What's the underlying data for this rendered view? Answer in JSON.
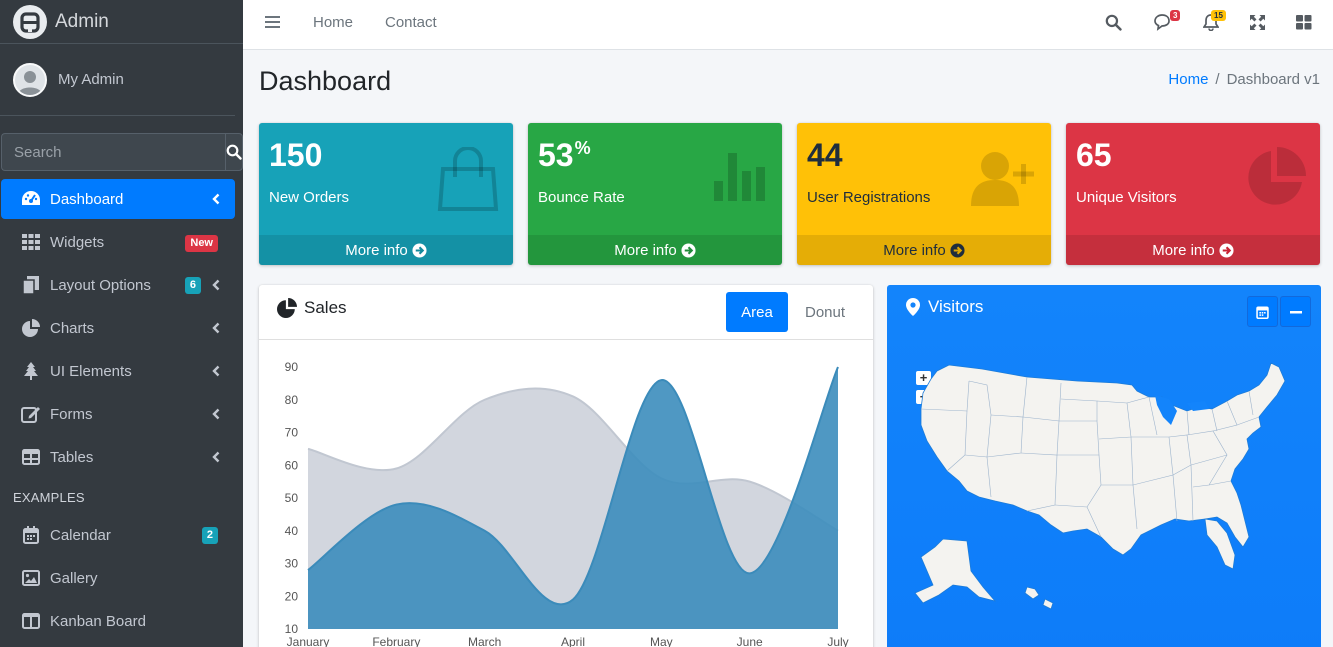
{
  "brand": {
    "name": "Admin"
  },
  "user": {
    "name": "My Admin"
  },
  "search": {
    "placeholder": "Search"
  },
  "sidebar": {
    "items": [
      {
        "label": "Dashboard",
        "icon": "tachometer-icon"
      },
      {
        "label": "Widgets",
        "icon": "grid-icon",
        "badge": "New"
      },
      {
        "label": "Layout Options",
        "icon": "copy-icon",
        "badge": "6"
      },
      {
        "label": "Charts",
        "icon": "pie-chart-icon"
      },
      {
        "label": "UI Elements",
        "icon": "tree-icon"
      },
      {
        "label": "Forms",
        "icon": "edit-icon"
      },
      {
        "label": "Tables",
        "icon": "table-icon"
      }
    ],
    "section_header": "EXAMPLES",
    "examples": [
      {
        "label": "Calendar",
        "icon": "calendar-icon",
        "badge": "2"
      },
      {
        "label": "Gallery",
        "icon": "image-icon"
      },
      {
        "label": "Kanban Board",
        "icon": "columns-icon"
      }
    ]
  },
  "topnav": {
    "links": [
      "Home",
      "Contact"
    ],
    "messages_count": "3",
    "notifications_count": "15"
  },
  "page": {
    "title": "Dashboard"
  },
  "breadcrumb": {
    "home": "Home",
    "current": "Dashboard v1"
  },
  "stats": [
    {
      "value": "150",
      "suffix": "",
      "label": "New Orders",
      "footer": "More info",
      "color": "#17a2b8",
      "icon": "shopping-bag-icon"
    },
    {
      "value": "53",
      "suffix": "%",
      "label": "Bounce Rate",
      "footer": "More info",
      "color": "#28a745",
      "icon": "bar-chart-icon"
    },
    {
      "value": "44",
      "suffix": "",
      "label": "User Registrations",
      "footer": "More info",
      "color": "#ffc107",
      "icon": "user-plus-icon"
    },
    {
      "value": "65",
      "suffix": "",
      "label": "Unique Visitors",
      "footer": "More info",
      "color": "#dc3545",
      "icon": "pie-chart-icon"
    }
  ],
  "sales": {
    "title": "Sales",
    "tabs": [
      "Area",
      "Donut"
    ],
    "active_tab": "Area"
  },
  "visitors": {
    "title": "Visitors"
  },
  "chart_data": {
    "type": "area",
    "categories": [
      "January",
      "February",
      "March",
      "April",
      "May",
      "June",
      "July"
    ],
    "ylim": [
      10,
      90
    ],
    "yticks": [
      10,
      20,
      30,
      40,
      50,
      60,
      70,
      80,
      90
    ],
    "series": [
      {
        "values": [
          65,
          59,
          80,
          81,
          56,
          55,
          40
        ],
        "color": "#d2d6de"
      },
      {
        "values": [
          28,
          48,
          40,
          19,
          86,
          27,
          90
        ],
        "color": "#3c8dbc"
      }
    ]
  }
}
